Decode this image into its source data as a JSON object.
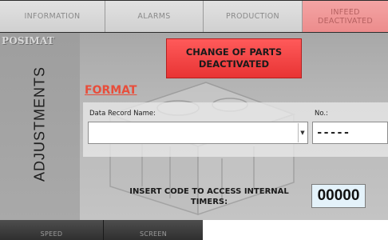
{
  "tabs": [
    {
      "label": "INFORMATION"
    },
    {
      "label": "ALARMS"
    },
    {
      "label": "PRODUCTION"
    },
    {
      "label": "INFEED\nDEACTIVATED"
    }
  ],
  "sidebar": {
    "logo_text": "POSIMAT",
    "title": "ADJUSTMENTS"
  },
  "change_parts_button": {
    "label": "CHANGE OF PARTS\nDEACTIVATED"
  },
  "format": {
    "title": "FORMAT",
    "record_label": "Data Record Name:",
    "record_value": "",
    "number_label": "No.:",
    "number_value": "-----"
  },
  "code_access": {
    "label": "INSERT CODE TO ACCESS INTERNAL\nTIMERS:",
    "value": "00000"
  },
  "bottom_tabs": [
    {
      "label": "SPEED"
    },
    {
      "label": "SCREEN"
    }
  ],
  "colors": {
    "accent_red": "#e83434",
    "format_title": "#e84d3a",
    "code_field_bg": "#e4f2fa"
  },
  "icons": {
    "select_arrow": "chevron-down-icon"
  }
}
